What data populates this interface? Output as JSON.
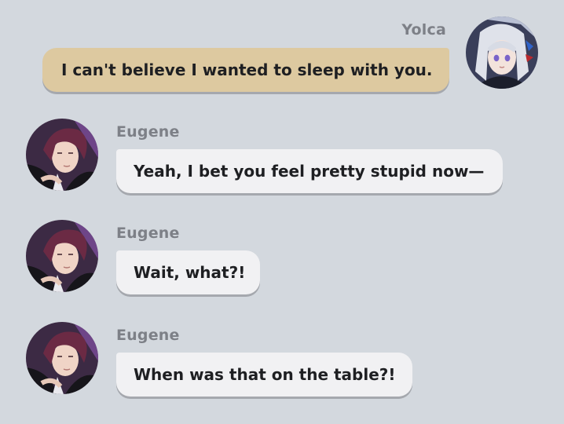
{
  "colors": {
    "background": "#d3d8de",
    "sent_bubble": "#ddc9a0",
    "received_bubble": "#f1f1f3",
    "name_text": "#7d8087",
    "message_text": "#1e1f22"
  },
  "messages": [
    {
      "sender": "Yolca",
      "side": "right",
      "text": "I can't believe I wanted to sleep with you.",
      "avatar_icon": "yolca-avatar-icon"
    },
    {
      "sender": "Eugene",
      "side": "left",
      "text": "Yeah, I bet you feel pretty stupid now—",
      "avatar_icon": "eugene-avatar-icon"
    },
    {
      "sender": "Eugene",
      "side": "left",
      "text": "Wait, what?!",
      "avatar_icon": "eugene-avatar-icon"
    },
    {
      "sender": "Eugene",
      "side": "left",
      "text": "When was that on the table?!",
      "avatar_icon": "eugene-avatar-icon"
    }
  ]
}
